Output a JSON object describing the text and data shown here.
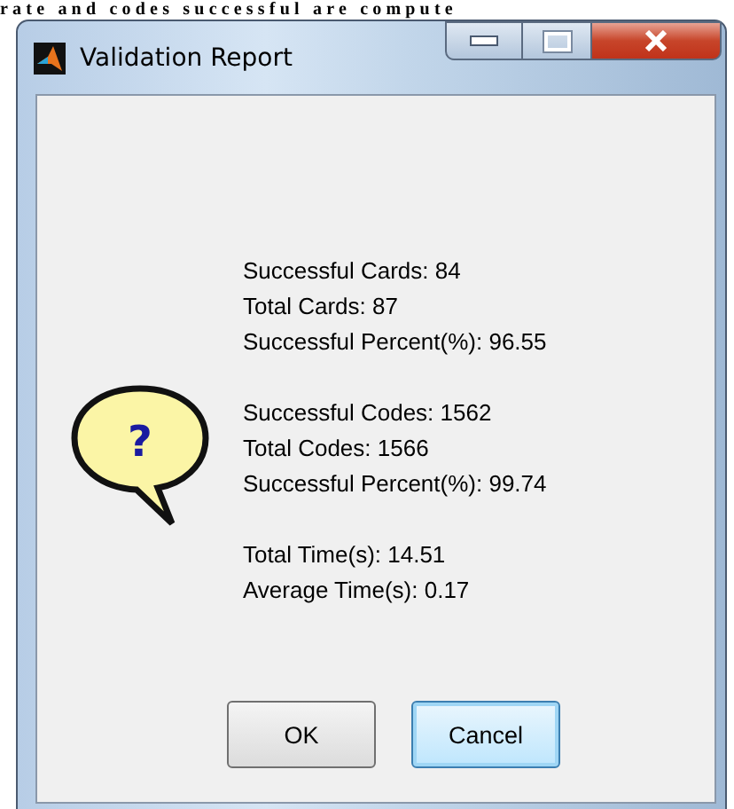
{
  "background_text": "rate and codes successful are compute",
  "window": {
    "title": "Validation Report"
  },
  "icon_glyph": "?",
  "message_groups": [
    [
      "Successful Cards: 84",
      "Total Cards: 87",
      "Successful Percent(%): 96.55"
    ],
    [
      "Successful Codes: 1562",
      "Total Codes: 1566",
      "Successful Percent(%): 99.74"
    ],
    [
      "Total Time(s): 14.51",
      "Average Time(s): 0.17"
    ]
  ],
  "buttons": [
    {
      "label": "OK",
      "selected": false
    },
    {
      "label": "Cancel",
      "selected": true
    }
  ]
}
